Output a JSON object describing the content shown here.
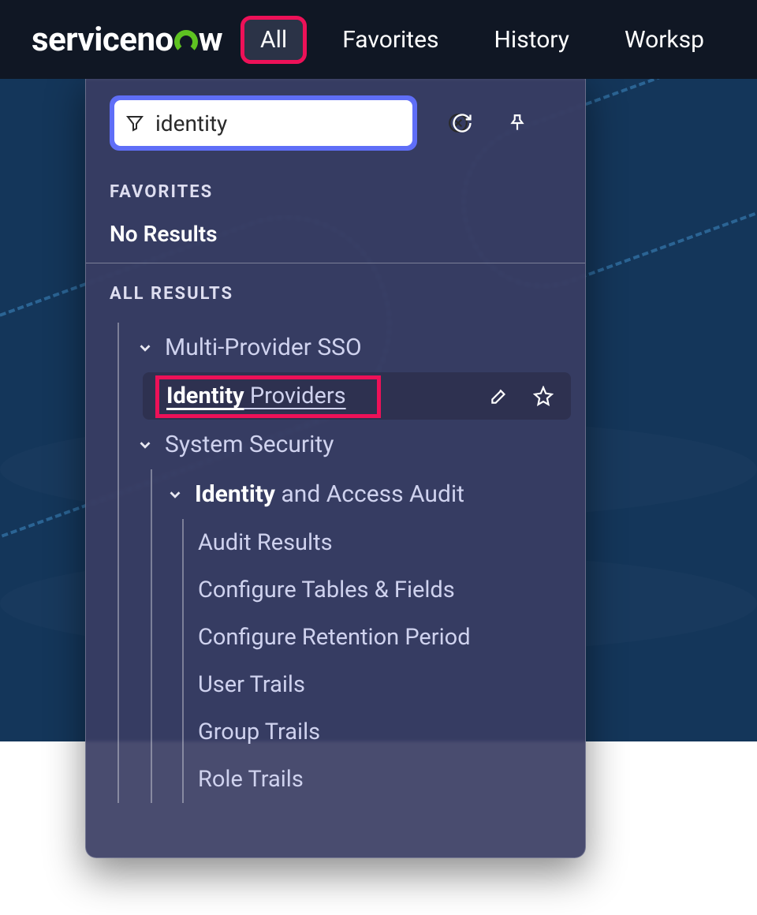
{
  "header": {
    "logo_text_a": "serviceno",
    "logo_text_b": "w",
    "tabs": {
      "all": "All",
      "favorites": "Favorites",
      "history": "History",
      "workspaces": "Worksp"
    }
  },
  "dropdown": {
    "search_value": "identity",
    "sections": {
      "favorites_label": "FAVORITES",
      "favorites_empty": "No Results",
      "all_results_label": "ALL RESULTS"
    },
    "tree": {
      "sso": {
        "label": "Multi-Provider SSO",
        "identity_providers_match": "Identity",
        "identity_providers_rest": " Providers"
      },
      "security": {
        "label": "System Security",
        "audit_group_match": "Identity",
        "audit_group_rest": " and Access Audit",
        "items": {
          "audit_results": "Audit Results",
          "configure_tables": "Configure Tables & Fields",
          "configure_retention": "Configure Retention Period",
          "user_trails": "User Trails",
          "group_trails": "Group Trails",
          "role_trails": "Role Trails"
        }
      }
    }
  },
  "icons": {
    "filter": "filter-icon",
    "clear": "clear-icon",
    "refresh": "refresh-icon",
    "pin": "pin-icon",
    "edit": "edit-icon",
    "star": "star-icon",
    "chevron": "chevron-down-icon"
  },
  "colors": {
    "highlight": "#ed1158",
    "accent_green": "#5ec221",
    "search_ring": "#5f6ef7",
    "panel_bg": "#3a3d63",
    "header_bg": "#101724"
  }
}
